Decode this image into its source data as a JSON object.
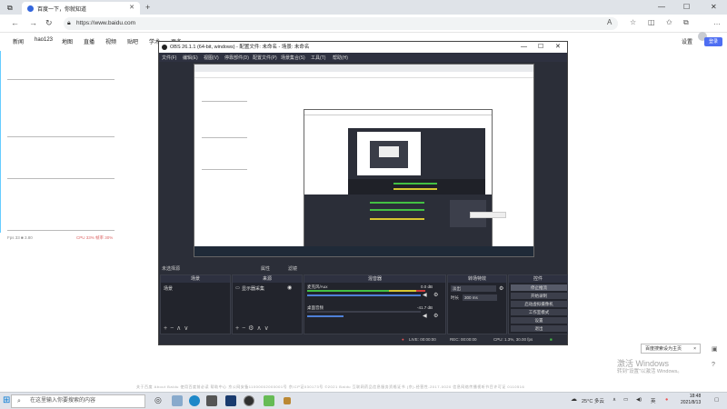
{
  "browser": {
    "tab_title": "百度一下，你就知道",
    "url": "https://www.baidu.com",
    "controls": {
      "min": "—",
      "max": "☐",
      "close": "✕"
    }
  },
  "baidu": {
    "nav": [
      "新闻",
      "hao123",
      "地图",
      "直播",
      "视频",
      "贴吧",
      "学术",
      "更多"
    ],
    "settings": "设置",
    "login": "登录",
    "left_stats": "Fps 33 ■ 3.80",
    "left_stats2": "CPU 33% 帧率 30%",
    "footer": "关于百度    About Baidu    使用百度前必读    帮助中心    京公网安备11000002000001号    京ICP证030173号    ©2021 Baidu    互联网药品信息服务资格证书 (京)-经营性-2017-0020    信息网络传播视听节目许可证 0110516"
  },
  "obs": {
    "title": "OBS 26.1.1 (64-bit, windows) - 配置文件: 未命名 - 场景: 未命名",
    "menu": [
      "文件(F)",
      "编辑(E)",
      "视图(V)",
      "停靠部件(D)",
      "配置文件(P)",
      "场景集合(S)",
      "工具(T)",
      "帮助(H)"
    ],
    "no_source": "未选择源",
    "properties": "属性",
    "filters": "滤镜",
    "panels": {
      "scenes": {
        "title": "场景",
        "items": [
          "场景"
        ]
      },
      "sources": {
        "title": "来源",
        "items": [
          "显示器采集"
        ]
      },
      "mixer": {
        "title": "混音器",
        "tracks": [
          {
            "name": "麦克风/Aux",
            "db": "0.0 dB"
          },
          {
            "name": "桌面音频",
            "db": "-41.7 dB"
          }
        ]
      },
      "transitions": {
        "title": "转场特效",
        "type": "淡出",
        "duration_label": "时长",
        "duration": "300 ms"
      },
      "controls": {
        "title": "控件",
        "buttons": [
          "停止推流",
          "开始录制",
          "启动虚拟摄像机",
          "工作室模式",
          "设置",
          "退出"
        ]
      }
    },
    "status": {
      "live": "LIVE: 00:00:00",
      "rec": "REC: 00:00:00",
      "cpu": "CPU: 1.3%, 30.00 fps"
    }
  },
  "notification": {
    "text": "百度搜索设为主页",
    "close": "×"
  },
  "watermark": {
    "line1": "激活 Windows",
    "line2": "转到\"设置\"以激活 Windows。"
  },
  "taskbar": {
    "search_placeholder": "在这里输入你要搜索的内容",
    "weather": "25°C 多云",
    "lang": "英",
    "time": "18:48",
    "date": "2021/8/13"
  },
  "colors": {
    "obs_bg": "#2b2e38",
    "accent": "#4e6ef2",
    "meter_green": "#43c043",
    "meter_yellow": "#d6c630",
    "meter_red": "#d33c3c"
  }
}
